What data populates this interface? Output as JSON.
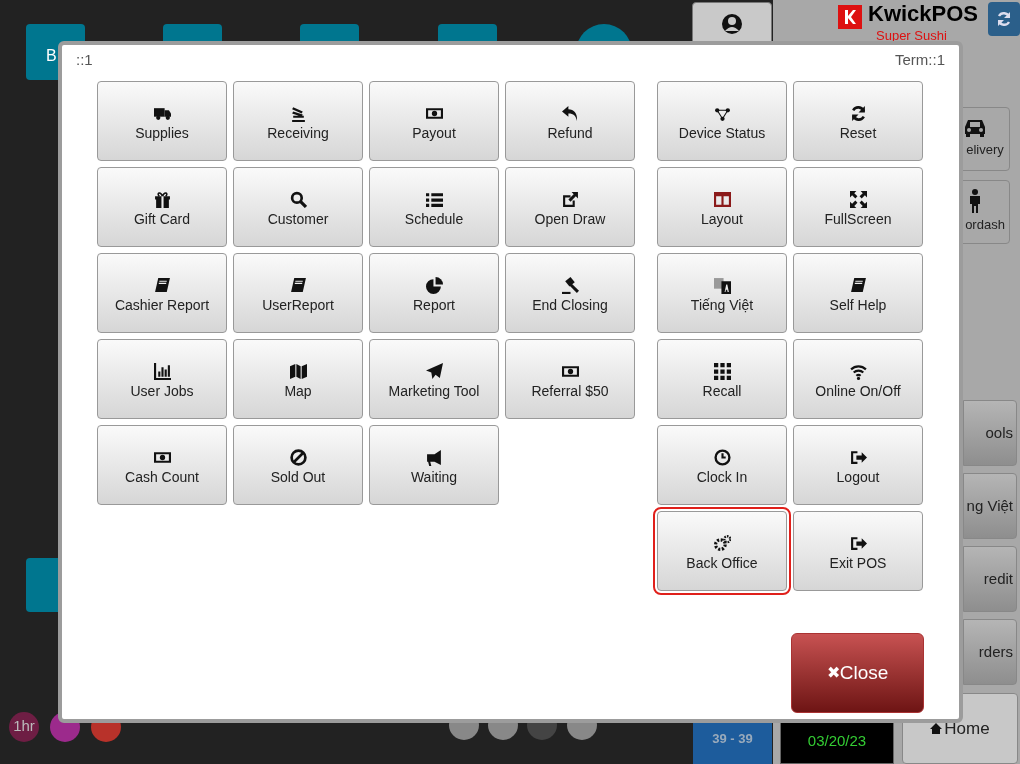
{
  "background": {
    "tiles": [
      "B"
    ],
    "brand": "KwickPOS",
    "store": "Super Sushi",
    "side_buttons": [
      "elivery",
      "ordash"
    ],
    "lower_buttons": [
      "ools",
      "ng Việt",
      "redit",
      "rders"
    ],
    "home": "Home",
    "timers": [
      "1hr"
    ],
    "counter": "39 - 39",
    "date": "03/20/23"
  },
  "dialog": {
    "station": "::1",
    "terminal": "Term::1",
    "left_buttons": [
      {
        "label": "Supplies",
        "selected": false
      },
      {
        "label": "Receiving",
        "selected": false
      },
      {
        "label": "Payout",
        "selected": false
      },
      {
        "label": "Refund",
        "selected": false
      },
      {
        "label": "Gift Card",
        "selected": false
      },
      {
        "label": "Customer",
        "selected": false
      },
      {
        "label": "Schedule",
        "selected": false
      },
      {
        "label": "Open Draw",
        "selected": false
      },
      {
        "label": "Cashier Report",
        "selected": false
      },
      {
        "label": "UserReport",
        "selected": false
      },
      {
        "label": "Report",
        "selected": false
      },
      {
        "label": "End Closing",
        "selected": false
      },
      {
        "label": "User Jobs",
        "selected": false
      },
      {
        "label": "Map",
        "selected": false
      },
      {
        "label": "Marketing Tool",
        "selected": false
      },
      {
        "label": "Referral $50",
        "selected": false
      },
      {
        "label": "Cash Count",
        "selected": false
      },
      {
        "label": "Sold Out",
        "selected": false
      },
      {
        "label": "Waiting",
        "selected": false
      }
    ],
    "right_buttons": [
      {
        "label": "Device Status",
        "selected": false
      },
      {
        "label": "Reset",
        "selected": false
      },
      {
        "label": "Layout",
        "selected": false
      },
      {
        "label": "FullScreen",
        "selected": false
      },
      {
        "label": "Tiếng Việt",
        "selected": false
      },
      {
        "label": "Self Help",
        "selected": false
      },
      {
        "label": "Recall",
        "selected": false
      },
      {
        "label": "Online On/Off",
        "selected": false
      },
      {
        "label": "Clock In",
        "selected": false
      },
      {
        "label": "Logout",
        "selected": false
      },
      {
        "label": "Back Office",
        "selected": true
      },
      {
        "label": "Exit POS",
        "selected": false
      }
    ],
    "close": {
      "icon": "✖",
      "label": "Close"
    }
  }
}
